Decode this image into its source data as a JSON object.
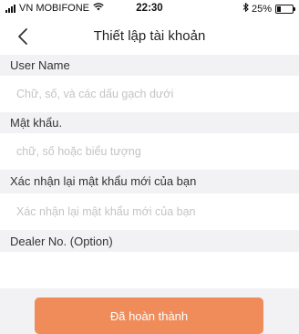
{
  "status_bar": {
    "carrier": "VN MOBIFONE",
    "time": "22:30",
    "battery_text": "25%",
    "battery_level": 0.25
  },
  "nav": {
    "title": "Thiết lập tài khoản",
    "back_icon": "chevron-left-icon"
  },
  "form": {
    "username": {
      "label": "User Name",
      "placeholder": "Chữ, số, và các dấu gạch dưới",
      "value": ""
    },
    "password": {
      "label": "Mật khẩu.",
      "placeholder": "chữ, số hoặc biểu tượng",
      "value": ""
    },
    "confirm_password": {
      "label": "Xác nhận lại mật khẩu mới của bạn",
      "placeholder": "Xác nhận lại mật khẩu mới của bạn",
      "value": ""
    },
    "dealer_no": {
      "label": "Dealer No. (Option)",
      "placeholder": "",
      "value": ""
    }
  },
  "done_button": {
    "label": "Đã hoàn thành"
  },
  "colors": {
    "accent": "#f08c5a",
    "background": "#f2f2f4",
    "placeholder": "#c4c4c4"
  }
}
